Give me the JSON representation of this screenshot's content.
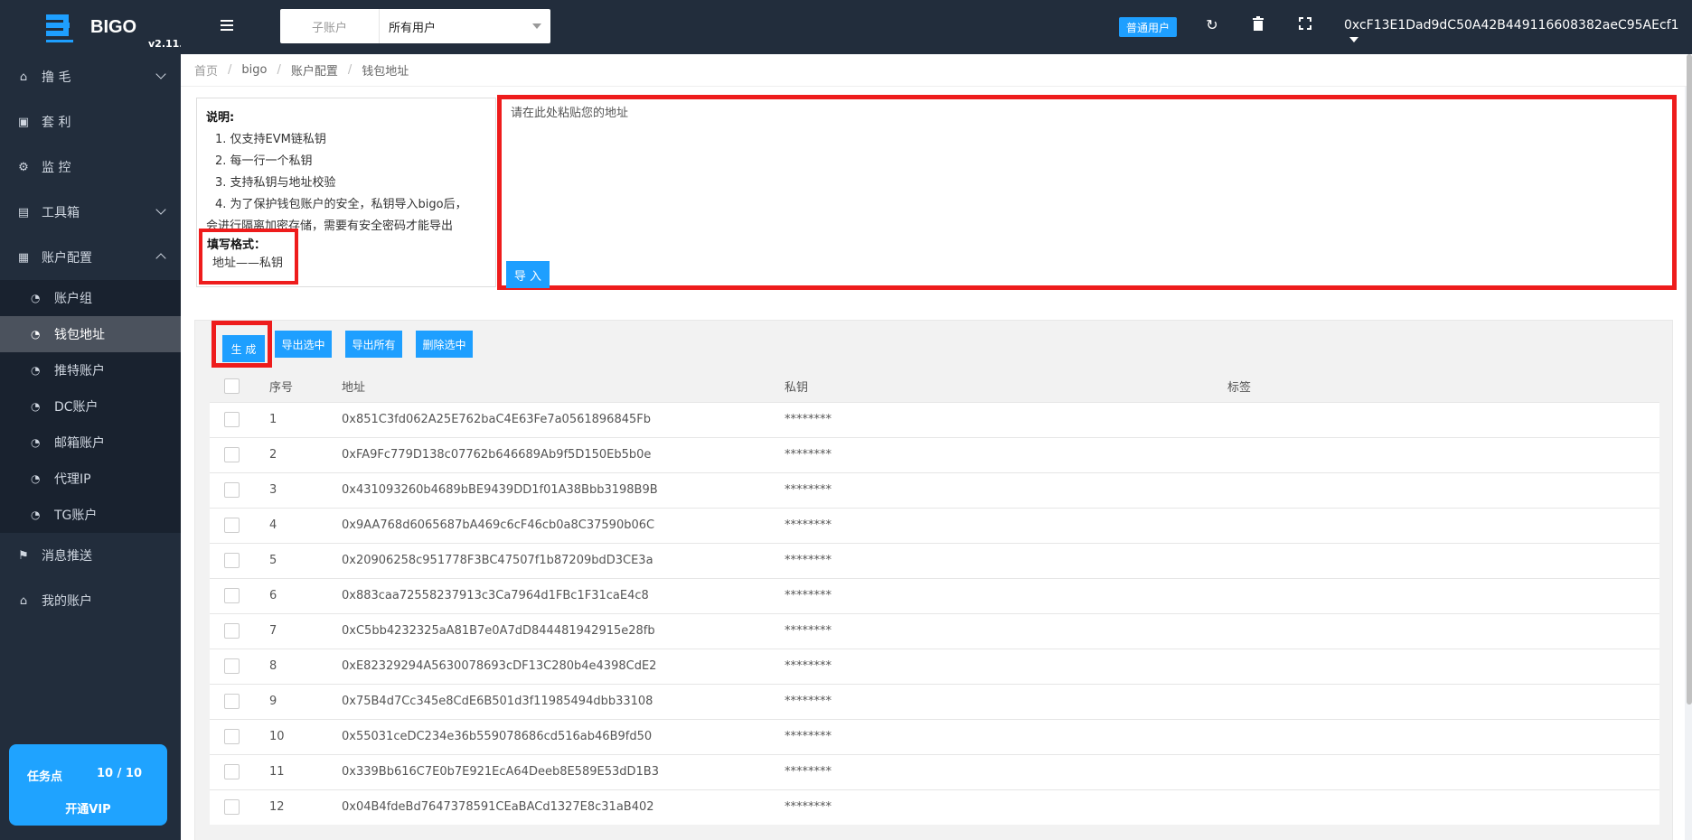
{
  "app": {
    "name": "BIGO",
    "version": "v2.11.0"
  },
  "sidebar": {
    "items": [
      {
        "label": "撸 毛",
        "icon": "home-icon",
        "expandable": true
      },
      {
        "label": "套 利",
        "icon": "window-icon",
        "expandable": false
      },
      {
        "label": "监 控",
        "icon": "gears-icon",
        "expandable": false
      },
      {
        "label": "工具箱",
        "icon": "file-icon",
        "expandable": true
      },
      {
        "label": "账户配置",
        "icon": "calendar-icon",
        "expandable": true
      }
    ],
    "submenu": [
      {
        "label": "账户组",
        "active": false
      },
      {
        "label": "钱包地址",
        "active": true
      },
      {
        "label": "推特账户",
        "active": false
      },
      {
        "label": "DC账户",
        "active": false
      },
      {
        "label": "邮箱账户",
        "active": false
      },
      {
        "label": "代理IP",
        "active": false
      },
      {
        "label": "TG账户",
        "active": false
      }
    ],
    "bottom_items": [
      {
        "label": "消息推送",
        "icon": "flag-icon"
      },
      {
        "label": "我的账户",
        "icon": "home-icon"
      }
    ],
    "vip": {
      "label": "任务点",
      "value": "10 / 10",
      "button": "开通VIP"
    }
  },
  "topbar": {
    "select_label": "子账户",
    "select_value": "所有用户",
    "user_badge": "普通用户",
    "wallet_address": "0xcF13E1Dad9dC50A42B449116608382aeC95AEcf1"
  },
  "breadcrumb": [
    "首页",
    "bigo",
    "账户配置",
    "钱包地址"
  ],
  "instructions": {
    "title": "说明:",
    "lines": [
      "1. 仅支持EVM链私钥",
      "2. 每一行一个私钥",
      "3. 支持私钥与地址校验",
      "4. 为了保护钱包账户的安全，私钥导入bigo后，",
      "会进行隔离加密存储，需要有安全密码才能导出"
    ],
    "format_title": "填写格式：",
    "format_line": "地址——私钥"
  },
  "paste": {
    "placeholder": "请在此处粘贴您的地址",
    "import_label": "导 入"
  },
  "toolbar": {
    "generate": "生 成",
    "export_selected": "导出选中",
    "export_all": "导出所有",
    "delete_selected": "删除选中"
  },
  "table": {
    "headers": [
      "序号",
      "地址",
      "私钥",
      "标签"
    ],
    "rows": [
      {
        "no": "1",
        "address": "0x851C3fd062A25E762baC4E63Fe7a0561896845Fb",
        "key": "********",
        "tag": ""
      },
      {
        "no": "2",
        "address": "0xFA9Fc779D138c07762b646689Ab9f5D150Eb5b0e",
        "key": "********",
        "tag": ""
      },
      {
        "no": "3",
        "address": "0x431093260b4689bBE9439DD1f01A38Bbb3198B9B",
        "key": "********",
        "tag": ""
      },
      {
        "no": "4",
        "address": "0x9AA768d6065687bA469c6cF46cb0a8C37590b06C",
        "key": "********",
        "tag": ""
      },
      {
        "no": "5",
        "address": "0x20906258c951778F3BC47507f1b87209bdD3CE3a",
        "key": "********",
        "tag": ""
      },
      {
        "no": "6",
        "address": "0x883caa72558237913c3Ca7964d1FBc1F31caE4c8",
        "key": "********",
        "tag": ""
      },
      {
        "no": "7",
        "address": "0xC5bb4232325aA81B7e0A7dD844481942915e28fb",
        "key": "********",
        "tag": ""
      },
      {
        "no": "8",
        "address": "0xE82329294A5630078693cDF13C280b4e4398CdE2",
        "key": "********",
        "tag": ""
      },
      {
        "no": "9",
        "address": "0x75B4d7Cc345e8CdE6B501d3f11985494dbb33108",
        "key": "********",
        "tag": ""
      },
      {
        "no": "10",
        "address": "0x55031ceDC234e36b559078686cd516ab46B9fd50",
        "key": "********",
        "tag": ""
      },
      {
        "no": "11",
        "address": "0x339Bb616C7E0b7E921EcA64Deeb8E589E53dD1B3",
        "key": "********",
        "tag": ""
      },
      {
        "no": "12",
        "address": "0x04B4fdeBd7647378591CEaBACd1327E8c31aB402",
        "key": "********",
        "tag": ""
      }
    ]
  }
}
